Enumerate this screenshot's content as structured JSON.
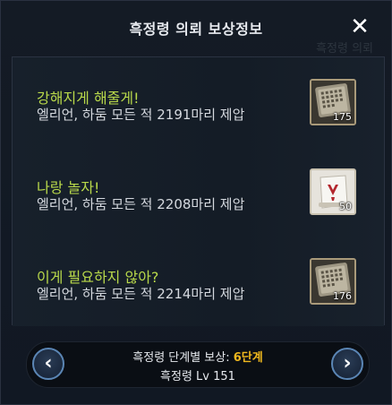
{
  "window": {
    "title": "흑정령 의뢰 보상정보",
    "close_icon": "close-icon"
  },
  "rewards": [
    {
      "title": "강해지게 해줄게!",
      "desc": "엘리언, 하둠 모든 적 2191마리 제압",
      "item_icon": "stone-tablet-icon",
      "count": "175"
    },
    {
      "title": "나랑 놀자!",
      "desc": "엘리언, 하둠 모든 적 2208마리 제압",
      "item_icon": "scroll-icon",
      "count": "50"
    },
    {
      "title": "이게 필요하지 않아?",
      "desc": "엘리언, 하둠 모든 적 2214마리 제압",
      "item_icon": "stone-tablet-icon",
      "count": "176"
    }
  ],
  "footer": {
    "stage_label": "흑정령 단계별 보상:",
    "stage_value": "6단계",
    "level_text": "흑정령 Lv 151",
    "prev_icon": "chevron-left-icon",
    "next_icon": "chevron-right-icon"
  },
  "colors": {
    "title_green": "#b9d94a",
    "stage_orange": "#f0b81e",
    "nav_blue": "#5b86b5"
  }
}
